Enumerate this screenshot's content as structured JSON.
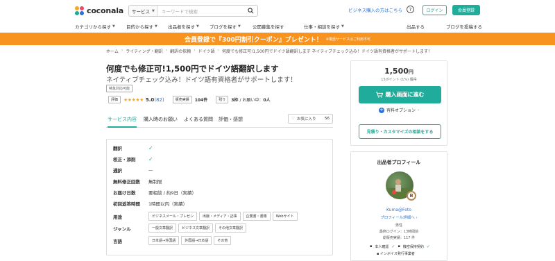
{
  "header": {
    "logo_text": "coconala",
    "search_category": "サービス",
    "search_placeholder": "キーワードで検索",
    "business_link": "ビジネス購入の方はこちら",
    "help_icon": "?",
    "login_label": "ログイン",
    "register_label": "会員登録"
  },
  "nav": {
    "left": [
      "カテゴリから探す",
      "目的から探す",
      "出品者を探す",
      "ブログを探す",
      "公開募集を探す",
      "仕事・相談を探す"
    ],
    "right": [
      "出品する",
      "ブログを投稿する"
    ]
  },
  "banner": {
    "main": "会員登録で『300円割引クーポン』プレゼント！",
    "note": "※電話サービスはご利用不可"
  },
  "breadcrumb": [
    "ホーム",
    "ライティング・翻訳",
    "翻訳の依頼",
    "ドイツ語",
    "何度でも修正可!1,500円でドイツ語翻訳します ネイティブチェック込み！ドイツ語有資格者がサポートします！"
  ],
  "service": {
    "title": "何度でも修正可!1,500円でドイツ語翻訳します",
    "subtitle": "ネイティブチェック込み！ドイツ語有資格者がサポートします！",
    "tag": "特急対応可能"
  },
  "stats": {
    "rating_label": "評価",
    "stars": "★★★★★",
    "rating": "5.0",
    "review_count": "(82)",
    "sales_label": "販売実績",
    "sales": "104件",
    "remaining_label": "残り",
    "remaining": "3枠",
    "in_progress_prefix": "/ お願い中：",
    "in_progress": "0人"
  },
  "tabs": [
    "サービス内容",
    "購入時のお願い",
    "よくある質問",
    "評価・感想"
  ],
  "favorite": {
    "label": "お気に入り",
    "count": "56"
  },
  "specs": [
    {
      "label": "翻訳",
      "value": "✓"
    },
    {
      "label": "校正・添削",
      "value": "✓"
    },
    {
      "label": "通訳",
      "value": "—"
    },
    {
      "label": "無料修正回数",
      "value": "無制限"
    },
    {
      "label": "お届け日数",
      "value": "要相談 / 約9日（実績）"
    },
    {
      "label": "初回返答時間",
      "value": "1時間以内（実績）"
    }
  ],
  "spec_chips": {
    "usage_label": "用途",
    "usage": [
      "ビジネスメール・プレゼン",
      "出版・メディア・記事",
      "企業書・書籍",
      "Webサイト"
    ],
    "genre_label": "ジャンル",
    "genre": [
      "一般文章翻訳",
      "ビジネス文章翻訳",
      "その他文章翻訳"
    ],
    "language_label": "言語",
    "language": [
      "日本語→外国語",
      "外国語→日本語",
      "その他"
    ]
  },
  "purchase": {
    "price": "1,500",
    "price_unit": "円",
    "points": "15ポイント (1%) 獲得",
    "buy_label": "購入画面に進む",
    "options_label": "有料オプション",
    "consult_label": "見積り・カスタマイズの相談をする"
  },
  "profile": {
    "title": "出品者プロフィール",
    "badge": "B",
    "name": "Kuma@Foto",
    "link": "プロフィール詳細へ",
    "gender": "男性",
    "last_login": "最終ログイン：13時間前",
    "total_sales": "総販売実績：117 件",
    "verify_1": "本人確認",
    "verify_2": "機密保持契約",
    "invoice": "インボイス発行事業者"
  },
  "colors": {
    "brand": "#1fac9b",
    "banner": "#f7931e",
    "link": "#2a74d8",
    "star": "#f5a623"
  }
}
